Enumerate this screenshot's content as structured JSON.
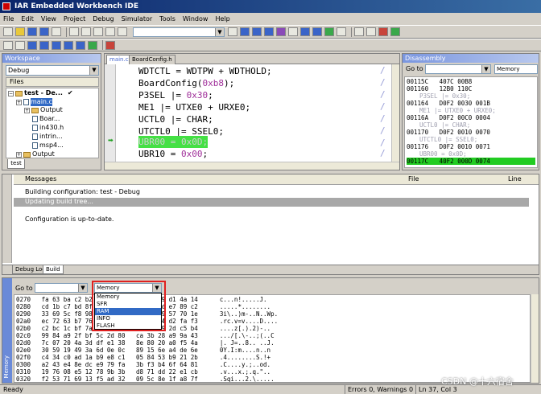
{
  "window": {
    "title": "IAR Embedded Workbench IDE"
  },
  "menu": [
    "File",
    "Edit",
    "View",
    "Project",
    "Debug",
    "Simulator",
    "Tools",
    "Window",
    "Help"
  ],
  "workspace": {
    "caption": "Workspace",
    "config": "Debug",
    "files_header": "Files",
    "tree": [
      {
        "label": "test - De...",
        "checked": "✔"
      },
      {
        "label": "main.c"
      },
      {
        "label": "Output"
      },
      {
        "label": "Boar..."
      },
      {
        "label": "in430.h"
      },
      {
        "label": "intrin..."
      },
      {
        "label": "msp4..."
      },
      {
        "label": "Output"
      }
    ],
    "tab": "test"
  },
  "editor": {
    "tabs": [
      "main.c",
      "BoardConfig.h"
    ],
    "lines": [
      {
        "pre": "WDTCTL = WDTPW + WDTHOLD;",
        "num": "",
        "post": ""
      },
      {
        "pre": "BoardConfig(",
        "num": "0xb8",
        "post": ");"
      },
      {
        "pre": "P3SEL |= ",
        "num": "0x30",
        "post": ";"
      },
      {
        "pre": "ME1 |= UTXE0 + URXE0;",
        "num": "",
        "post": ""
      },
      {
        "pre": "UCTL0 |= CHAR;",
        "num": "",
        "post": ""
      },
      {
        "pre": "UTCTL0 |= SSEL0;",
        "num": "",
        "post": ""
      },
      {
        "pre": "UBR00 = 0x0D;",
        "num": "",
        "post": ""
      },
      {
        "pre": "UBR10 = ",
        "num": "0x00",
        "post": ";"
      }
    ],
    "comment_mark": "/"
  },
  "disassembly": {
    "caption": "Disassembly",
    "goto_label": "Go to",
    "memory_select": "Memory",
    "lines": [
      {
        "text": "00115C   407C 00B8",
        "type": "code"
      },
      {
        "text": "001160   12B0 110C",
        "type": "code"
      },
      {
        "text": "P3SEL |= 0x30;",
        "type": "src"
      },
      {
        "text": "001164   D0F2 0030 001B",
        "type": "code"
      },
      {
        "text": "ME1 |= UTXE0 + URXE0;",
        "type": "src"
      },
      {
        "text": "00116A   D0F2 00C0 0004",
        "type": "code"
      },
      {
        "text": "UCTL0 |= CHAR;",
        "type": "src"
      },
      {
        "text": "001170   D0F2 0010 0070",
        "type": "code"
      },
      {
        "text": "UTCTL0 |= SSEL0;",
        "type": "src"
      },
      {
        "text": "001176   D0F2 0010 0071",
        "type": "code"
      },
      {
        "text": "UBR00 = 0x0D;",
        "type": "src"
      },
      {
        "text": "00117C   40F2 000D 0074",
        "type": "hl"
      }
    ]
  },
  "messages": {
    "header_messages": "Messages",
    "header_file": "File",
    "header_line": "Line",
    "items": [
      "Building configuration: test - Debug",
      "Updating build tree...",
      "Configuration is up-to-date."
    ],
    "tabs": [
      "Debug Log",
      "Build"
    ]
  },
  "memory": {
    "side_label": "Memory",
    "goto_label": "Go to",
    "zone_selected": "Memory",
    "zone_options": [
      "Memory",
      "SFR",
      "RAM",
      "INFO",
      "FLASH"
    ],
    "zone_highlighted": "RAM",
    "rows": [
      "0270   fa 63 ba c2 b2 04 b4 c6   f8 bc f9 d1 4a 14      c...n!.....J.",
      "0280   cd 1b c7 bd 8f 05 68 a7   0a a7 cd e7 89 c2      .....*........",
      "0290   33 69 5c f8 98 8e 4a 4b   4e af d9 57 70 1e      3i\\..)m-..N..Wp.",
      "02a0   ec 72 63 b7 76 9a 76 2d   e9 ef 44 d2 fa f3      .rc.v=v....D....",
      "02b0   c2 bc 1c bf 7a 5b 16 29   9a 32 29 2d c5 b4      ....z[.).2)-..",
      "02c0   99 84 a9 2f bf 5c 2d 80   ca 3b 28 a9 9a 43      .../[.\\-..;(..C",
      "02d0   7c 07 20 4a 3d df e1 38   8e 80 20 a0 f5 4a      |. J=..8.. ..J.",
      "02e0   30 59 19 49 3a 6d 0e 0c   89 15 6e a4 de 6e      0Y.I:m....n..n",
      "02f0   c4 34 c0 ad 1a b9 e8 c1   05 84 53 b9 21 2b      .4........S.!+",
      "0300   a2 43 e4 8e dc e9 79 fa   3b f3 b4 6f 64 81      .C....y.;..od.",
      "0310   19 76 08 e5 12 78 9b 3b   d8 71 dd 22 e1 cb      .v...x.;.q.\"..",
      "0320   f2 53 71 69 13 f5 ad 32   09 5c 8e 1f a8 7f      .Sqi...2.\\....."
    ]
  },
  "status": {
    "ready": "Ready",
    "errors": "Errors 0, Warnings 0",
    "position": "Ln 37, Col 3"
  },
  "watermark": "CSDN @十六宿舍",
  "colors": {
    "title_bar": "#0a246a",
    "highlight_green": "#44e044",
    "red_box": "#e02020",
    "selection": "#316ac5"
  }
}
